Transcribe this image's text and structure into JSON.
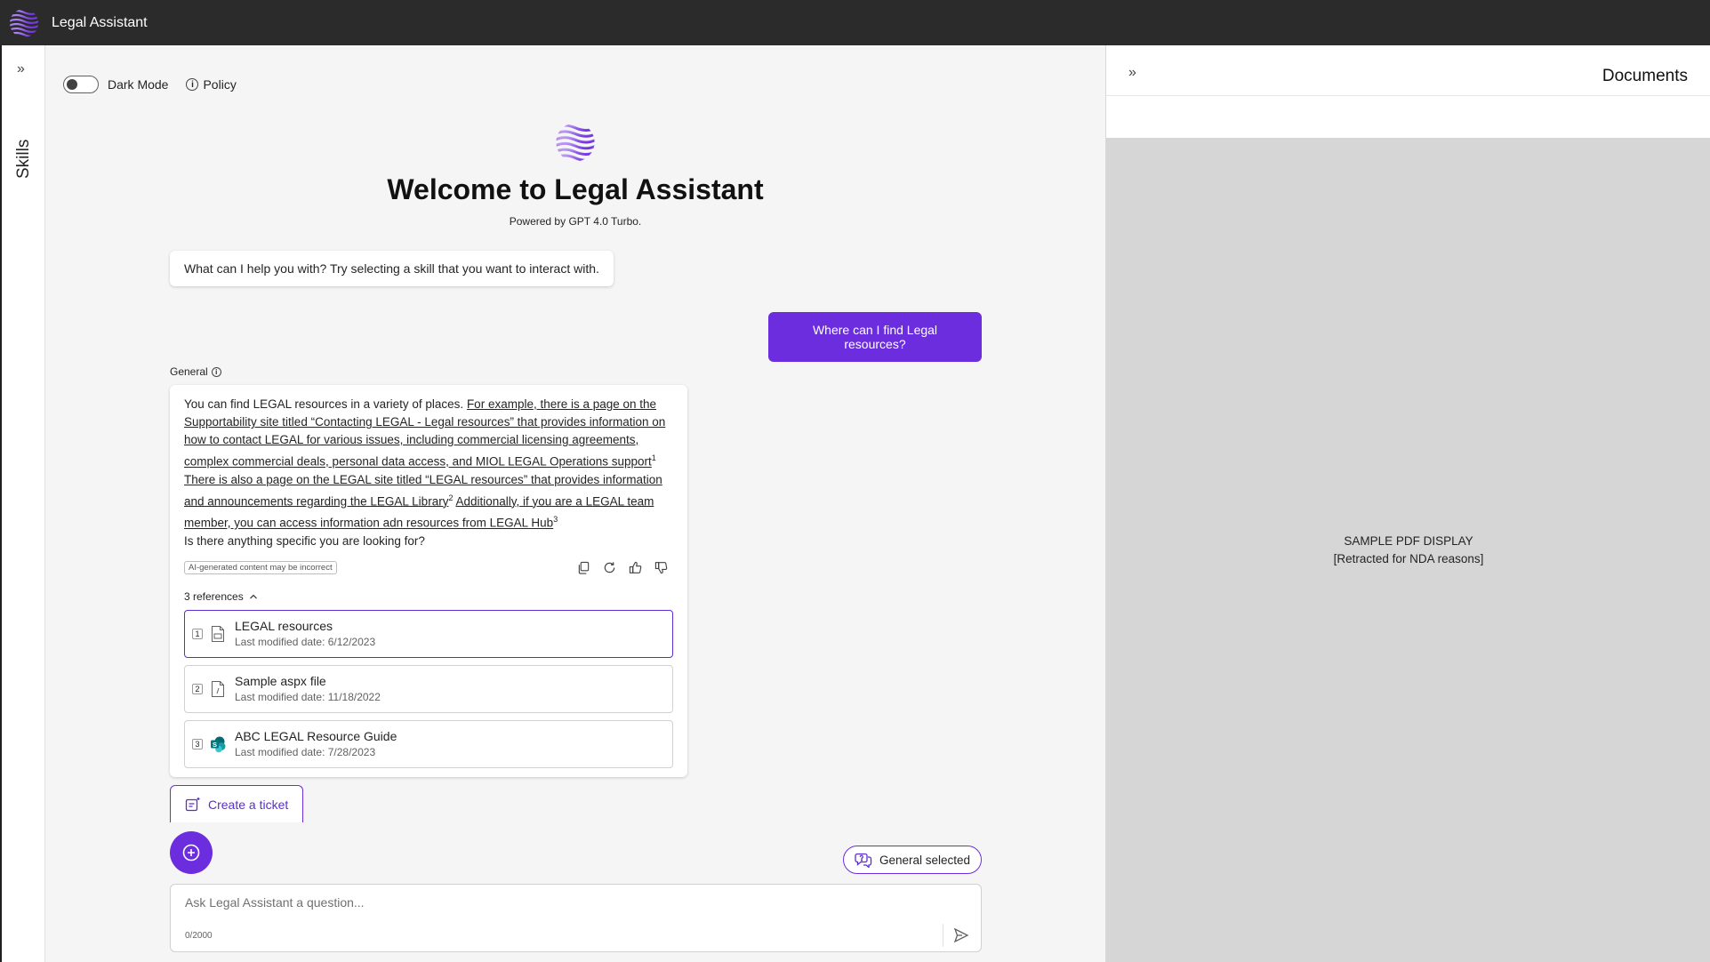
{
  "app": {
    "title": "Legal Assistant"
  },
  "left_rail": {
    "label": "Skills"
  },
  "toolbar": {
    "dark_mode_label": "Dark Mode",
    "policy_label": "Policy"
  },
  "hero": {
    "title": "Welcome to Legal Assistant",
    "subtitle": "Powered by GPT 4.0 Turbo."
  },
  "chat": {
    "bot_greeting": "What can I help you with? Try selecting a skill that you want to interact with.",
    "user_message": "Where can I find Legal resources?",
    "answer_skill_label": "General",
    "answer": {
      "p1_plain": "You can find LEGAL resources in a variety of places. ",
      "p1_link": "For example, there is a page on the Supportability site titled “Contacting LEGAL - Legal resources” that provides information on how to contact LEGAL for various issues, including commercial licensing agreements, complex commercial deals, personal data access, and MIOL LEGAL Operations support",
      "p1_ref": "1",
      "p2_link": "There is also a page on the LEGAL site titled “LEGAL resources” that provides information and announcements regarding the LEGAL Library",
      "p2_ref": "2",
      "p3_link": "Additionally, if you are a LEGAL team member, you can access information adn resources from LEGAL Hub",
      "p3_ref": "3",
      "closing": "Is there anything specific you are looking for?"
    },
    "ai_disclaimer": "AI-generated content may be incorrect",
    "references_toggle": "3 references",
    "references": [
      {
        "num": "1",
        "title": "LEGAL resources",
        "date": "Last modified date: 6/12/2023",
        "icon": "document-icon"
      },
      {
        "num": "2",
        "title": "Sample aspx file",
        "date": "Last modified date: 11/18/2022",
        "icon": "file-code-icon"
      },
      {
        "num": "3",
        "title": "ABC LEGAL Resource Guide",
        "date": "Last modified date: 7/28/2023",
        "icon": "sharepoint-icon"
      }
    ]
  },
  "ticket_button": {
    "label": "Create a ticket"
  },
  "skill_chip": {
    "label": "General selected"
  },
  "composer": {
    "placeholder": "Ask Legal Assistant a question...",
    "counter": "0/2000"
  },
  "documents_panel": {
    "title": "Documents",
    "pdf_line1": "SAMPLE PDF DISPLAY",
    "pdf_line2": "[Retracted for NDA reasons]"
  },
  "colors": {
    "accent": "#6b2ddd",
    "topbar": "#2b2b2b",
    "pdf_bg": "#d6d6d6"
  }
}
